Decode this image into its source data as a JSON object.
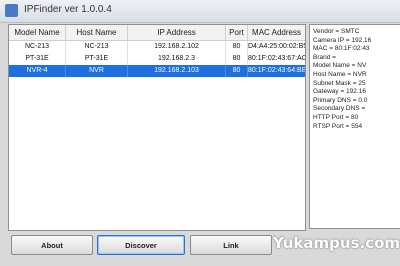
{
  "window": {
    "title": "IPFinder ver 1.0.0.4"
  },
  "table": {
    "headers": [
      "Model Name",
      "Host Name",
      "IP Address",
      "Port",
      "MAC Address"
    ],
    "rows": [
      [
        "NC-213",
        "NC-213",
        "192.168.2.102",
        "80",
        "D4:A4:25:00:02:B5"
      ],
      [
        "PT-31E",
        "PT-31E",
        "192.168.2.3",
        "80",
        "80:1F:02:43:67:AC"
      ],
      [
        "NVR-4",
        "NVR",
        "192.168.2.103",
        "80",
        "80:1F:02:43:64:BE"
      ]
    ],
    "selected_row": 2
  },
  "info": {
    "lines": [
      "Vendor = SMTC",
      "Camera IP = 192.16",
      "MAC = 80:1F:02:43",
      "Brand =",
      "Model Name = NV",
      "Host Name = NVR",
      "Subnet Mask = 25",
      "Gateway = 192.16",
      "Primary DNS = 0.0",
      "Secondary DNS =",
      "HTTP Port = 80",
      "RTSP Port = 554"
    ]
  },
  "buttons": {
    "about": "About",
    "discover": "Discover",
    "link": "Link"
  },
  "watermark": "Yukampus.com",
  "colors": {
    "selection": "#1e6fe0",
    "focus_border": "#2f6fd0"
  }
}
